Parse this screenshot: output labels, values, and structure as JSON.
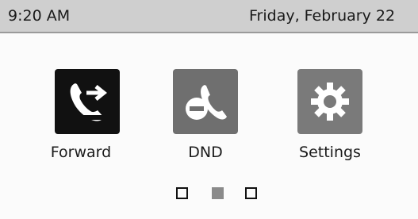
{
  "status_bar": {
    "time": "9:20 AM",
    "date": "Friday, February 22"
  },
  "apps": [
    {
      "label": "Forward",
      "icon": "call-forward-icon"
    },
    {
      "label": "DND",
      "icon": "do-not-disturb-icon"
    },
    {
      "label": "Settings",
      "icon": "gear-icon"
    }
  ],
  "pager": {
    "page_count": 3,
    "current_page": 2
  },
  "colors": {
    "status_bar_bg": "#cfcfcf",
    "screen_bg": "#fbfbfb",
    "forward_tile": "#111111",
    "dnd_tile": "#6f6f6f",
    "settings_tile": "#7a7a7a"
  }
}
